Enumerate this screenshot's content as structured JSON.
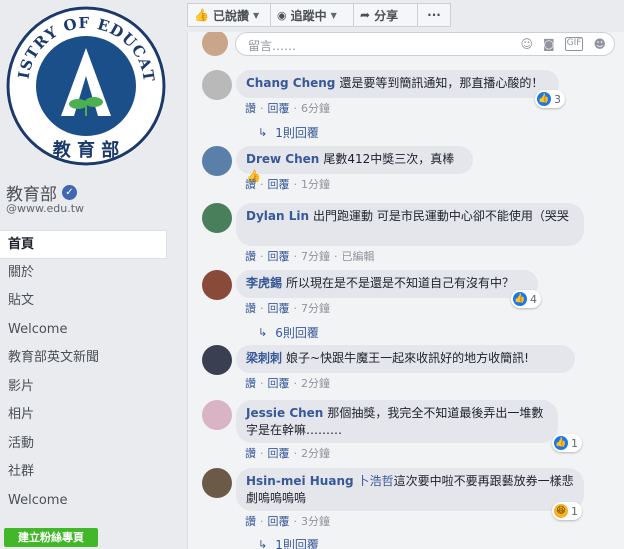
{
  "sidebar": {
    "logo_text": "MINISTRY OF EDUCATION",
    "logo_cn": "教育部",
    "page_name": "教育部",
    "handle": "@www.edu.tw",
    "nav": [
      "首頁",
      "關於",
      "貼文",
      "Welcome",
      "教育部英文新聞",
      "影片",
      "相片",
      "活動",
      "社群",
      "Welcome"
    ],
    "create_button": "建立粉絲專頁"
  },
  "topbar": {
    "liked": "已說讚",
    "following": "追蹤中",
    "share": "分享",
    "more": "···"
  },
  "composer": {
    "placeholder": "留言……"
  },
  "comments": [
    {
      "author": "Chang Cheng",
      "text": "還是要等到簡訊通知，那直播心酸的！",
      "like": "讚",
      "reply": "回覆",
      "time": "6分鐘",
      "reactions": "3",
      "replies": "1則回覆"
    },
    {
      "author": "Drew Chen",
      "text": "尾數412中獎三次，真棒👍",
      "like": "讚",
      "reply": "回覆",
      "time": "1分鐘"
    },
    {
      "author": "Dylan Lin",
      "text": "出門跑運動 可是市民運動中心卻不能使用（哭哭",
      "like": "讚",
      "reply": "回覆",
      "time": "7分鐘",
      "edited": "已編輯"
    },
    {
      "author": "李虎錫",
      "text": "所以現在是不是還是不知道自己有沒有中？",
      "like": "讚",
      "reply": "回覆",
      "time": "7分鐘",
      "reactions": "4",
      "replies": "6則回覆"
    },
    {
      "author": "梁刺刺",
      "text": "娘子~快跟牛魔王一起來收訊好的地方收簡訊!",
      "like": "讚",
      "reply": "回覆",
      "time": "2分鐘"
    },
    {
      "author": "Jessie Chen",
      "text": "那個抽獎，我完全不知道最後弄出一堆數字是在幹嘛………",
      "like": "讚",
      "reply": "回覆",
      "time": "2分鐘",
      "reactions": "1"
    },
    {
      "author": "Hsin-mei Huang",
      "tag": "卜浩哲",
      "text": "這次要中啦不要再跟藝放券一樣悲劇嗚嗚嗚嗚",
      "like": "讚",
      "reply": "回覆",
      "time": "3分鐘",
      "reactions": "1",
      "replies": "1則回覆"
    }
  ],
  "colors": {
    "link": "#385898",
    "accent": "#4267b2",
    "green": "#42b72a"
  }
}
